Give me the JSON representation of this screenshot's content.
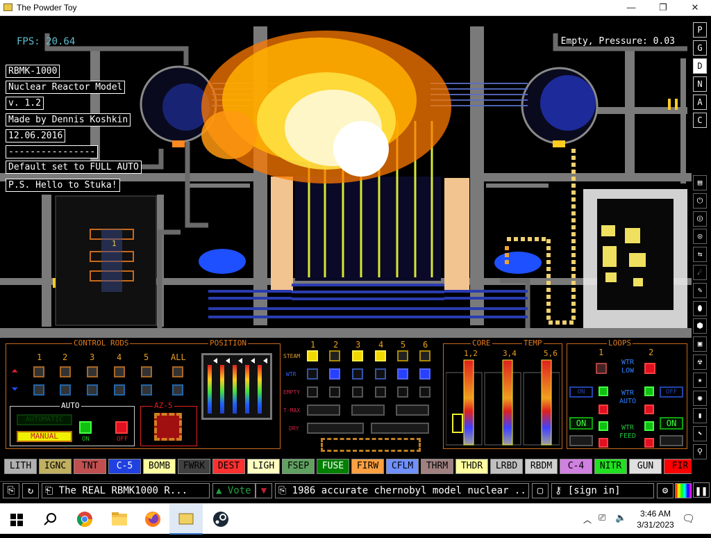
{
  "window": {
    "title": "The Powder Toy",
    "minimize": "—",
    "maximize": "❐",
    "close": "✕"
  },
  "hud": {
    "fps": "FPS: 20.64",
    "pressure": "Empty, Pressure: 0.03"
  },
  "save_info": [
    "RBMK-1000",
    "Nuclear Reactor Model",
    "v. 1.2",
    "Made by Dennis Koshkin",
    "12.06.2016",
    "----------------",
    "Default set to FULL AUTO",
    "P.S. Hello to Stuka!"
  ],
  "right_menu": [
    "P",
    "G",
    "D",
    "N",
    "A",
    "C"
  ],
  "right_menu_active": "D",
  "right_tools": [
    "wall-icon",
    "power-icon",
    "sensor-icon",
    "force-icon",
    "explosive-icon",
    "gas-icon",
    "solid-icon",
    "liquid-icon",
    "powder-icon",
    "special-icon",
    "radioactive-icon",
    "star-icon",
    "life-icon",
    "bookmark-icon",
    "tools-icon",
    "search-icon"
  ],
  "panel": {
    "control_rods": {
      "title": "CONTROL RODS",
      "columns": [
        "1",
        "2",
        "3",
        "4",
        "5",
        "ALL"
      ]
    },
    "position": {
      "title": "POSITION"
    },
    "auto": {
      "title": "AUTO",
      "auto_button": "AUTOMATIC",
      "manual_button": "MANUAL",
      "on": "ON",
      "off": "OFF"
    },
    "az5": {
      "title": "AZ-5"
    },
    "channels": {
      "columns": [
        "1",
        "2",
        "3",
        "4",
        "5",
        "6"
      ],
      "rows": [
        "STEAM",
        "WTR",
        "EMPTY",
        "T-MAX",
        "DRY"
      ],
      "steam_states": [
        "yellow",
        "dark",
        "yellow",
        "yellow",
        "dark",
        "dark"
      ],
      "wtr_states": [
        "dark",
        "blue",
        "dark",
        "dark",
        "blue",
        "blue"
      ]
    },
    "core_temp": {
      "title_left": "CORE",
      "title_right": "TEMP",
      "labels": [
        "1,2",
        "3,4",
        "5,6"
      ]
    },
    "loops": {
      "title": "LOOPS",
      "columns": [
        "1",
        "2"
      ],
      "wtr_low": "WTR LOW",
      "wtr_auto": "WTR AUTO",
      "wtr_feed": "WTR FEED",
      "on_left": "ON",
      "on_right": "ON",
      "on_small": "ON",
      "off_small": "OFF"
    }
  },
  "elements": [
    {
      "label": "LITH",
      "color": "#b0b0b0",
      "text": "#000000"
    },
    {
      "label": "IGNC",
      "color": "#c0b060",
      "text": "#000000"
    },
    {
      "label": "TNT",
      "color": "#c05050",
      "text": "#000000"
    },
    {
      "label": "C-5",
      "color": "#2040e0",
      "text": "#ffffff"
    },
    {
      "label": "BOMB",
      "color": "#ffffa0",
      "text": "#000000"
    },
    {
      "label": "FWRK",
      "color": "#404040",
      "text": "#000000"
    },
    {
      "label": "DEST",
      "color": "#ff3030",
      "text": "#000000"
    },
    {
      "label": "LIGH",
      "color": "#ffffc0",
      "text": "#000000"
    },
    {
      "label": "FSEP",
      "color": "#60a060",
      "text": "#000000"
    },
    {
      "label": "FUSE",
      "color": "#008000",
      "text": "#ffffff"
    },
    {
      "label": "FIRW",
      "color": "#ffa040",
      "text": "#000000"
    },
    {
      "label": "CFLM",
      "color": "#7090ff",
      "text": "#000000"
    },
    {
      "label": "THRM",
      "color": "#a08080",
      "text": "#000000"
    },
    {
      "label": "THDR",
      "color": "#ffffa0",
      "text": "#000000"
    },
    {
      "label": "LRBD",
      "color": "#c0c0c0",
      "text": "#000000"
    },
    {
      "label": "RBDM",
      "color": "#d0d0d0",
      "text": "#000000"
    },
    {
      "label": "C-4",
      "color": "#d080e0",
      "text": "#000000"
    },
    {
      "label": "NITR",
      "color": "#20e020",
      "text": "#000000"
    },
    {
      "label": "GUN",
      "color": "#e0e0e0",
      "text": "#000000"
    },
    {
      "label": "FIR",
      "color": "#ff0000",
      "text": "#000000"
    }
  ],
  "bottom": {
    "save_title": "The REAL RBMK1000 R...",
    "vote": "Vote",
    "description": "1986 accurate chernobyl model nuclear ...",
    "sign_in": "[sign in]"
  },
  "taskbar": {
    "time": "3:46 AM",
    "date": "3/31/2023"
  }
}
